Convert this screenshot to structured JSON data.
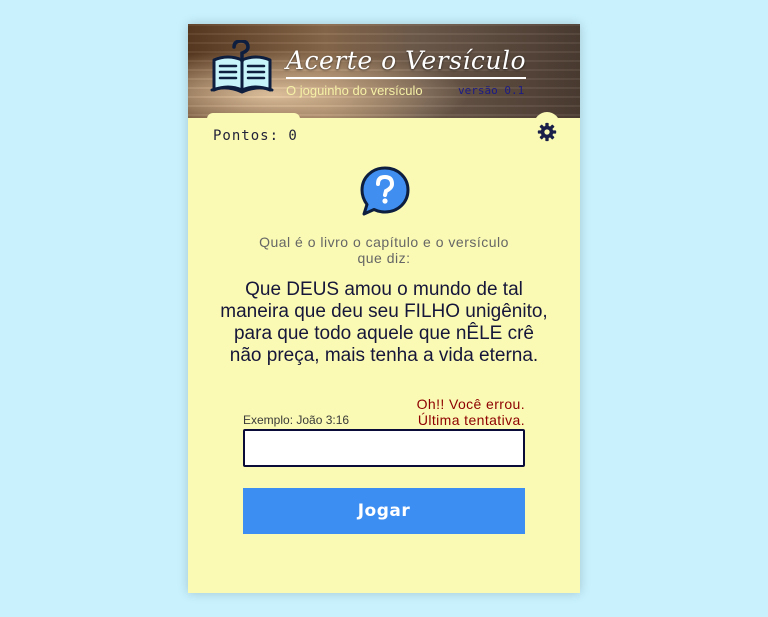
{
  "header": {
    "title": "Acerte o Versículo",
    "subtitle": "O joguinho do versículo",
    "version": "versão 0.1",
    "logo_icon": "open-book-question-icon"
  },
  "score": {
    "text": "Pontos: 0"
  },
  "settings": {
    "icon": "gear-icon"
  },
  "question": {
    "icon": "speech-bubble-question-icon",
    "prompt": "Qual é o livro o capítulo e o versículo que diz:",
    "verse": "Que DEUS amou o mundo de tal maneira que deu seu FILHO unigênito, para que todo aquele que nÊLE crê não preça, mais tenha a vida eterna."
  },
  "feedback": {
    "line1": "Oh!! Você errou.",
    "line2": "Última tentativa.",
    "color": "#8e0000"
  },
  "answer": {
    "label": "Exemplo: João 3:16",
    "value": "",
    "placeholder": ""
  },
  "play_button": {
    "label": "Jogar",
    "color": "#3d8ef2"
  },
  "colors": {
    "page_background": "#c8f1fd",
    "card_background": "#fafab4",
    "accent": "#3d8ef2"
  }
}
